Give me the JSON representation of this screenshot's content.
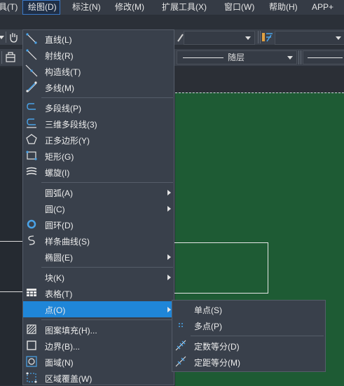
{
  "menubar": {
    "items": [
      {
        "label": "具(T)"
      },
      {
        "label": "绘图(D)"
      },
      {
        "label": "标注(N)"
      },
      {
        "label": "修改(M)"
      },
      {
        "label": "扩展工具(X)"
      },
      {
        "label": "窗口(W)"
      },
      {
        "label": "帮助(H)"
      },
      {
        "label": "APP+"
      }
    ]
  },
  "toolbar": {
    "layer_label": "随层"
  },
  "draw_menu": {
    "items": [
      {
        "label": "直线(L)",
        "icon": "line-icon"
      },
      {
        "label": "射线(R)",
        "icon": "ray-icon"
      },
      {
        "label": "构造线(T)",
        "icon": "construction-line-icon"
      },
      {
        "label": "多线(M)",
        "icon": "multiline-icon"
      },
      {
        "label": "多段线(P)",
        "icon": "polyline-icon"
      },
      {
        "label": "三维多段线(3)",
        "icon": "3d-polyline-icon"
      },
      {
        "label": "正多边形(Y)",
        "icon": "polygon-icon"
      },
      {
        "label": "矩形(G)",
        "icon": "rectangle-icon"
      },
      {
        "label": "螺旋(I)",
        "icon": "helix-icon"
      },
      {
        "label": "圆弧(A)",
        "icon": "",
        "submenu": true
      },
      {
        "label": "圆(C)",
        "icon": "",
        "submenu": true
      },
      {
        "label": "圆环(D)",
        "icon": "donut-icon"
      },
      {
        "label": "样条曲线(S)",
        "icon": "spline-icon"
      },
      {
        "label": "椭圆(E)",
        "icon": "",
        "submenu": true
      },
      {
        "label": "块(K)",
        "icon": "",
        "submenu": true
      },
      {
        "label": "表格(T)",
        "icon": "table-icon"
      },
      {
        "label": "点(O)",
        "icon": "",
        "submenu": true,
        "highlighted": true
      },
      {
        "label": "图案填充(H)...",
        "icon": "hatch-icon"
      },
      {
        "label": "边界(B)...",
        "icon": "boundary-icon"
      },
      {
        "label": "面域(N)",
        "icon": "region-icon"
      },
      {
        "label": "区域覆盖(W)",
        "icon": "wipeout-icon"
      }
    ]
  },
  "point_submenu": {
    "items": [
      {
        "label": "单点(S)",
        "icon": ""
      },
      {
        "label": "多点(P)",
        "icon": "multiple-points-icon"
      },
      {
        "label": "定数等分(D)",
        "icon": "divide-icon"
      },
      {
        "label": "定距等分(M)",
        "icon": "measure-icon"
      }
    ]
  },
  "colors": {
    "canvas": "#1e5b34",
    "highlight": "#1f86d8",
    "menu_bg": "#39404b",
    "icon_blue": "#4aa3e8"
  }
}
